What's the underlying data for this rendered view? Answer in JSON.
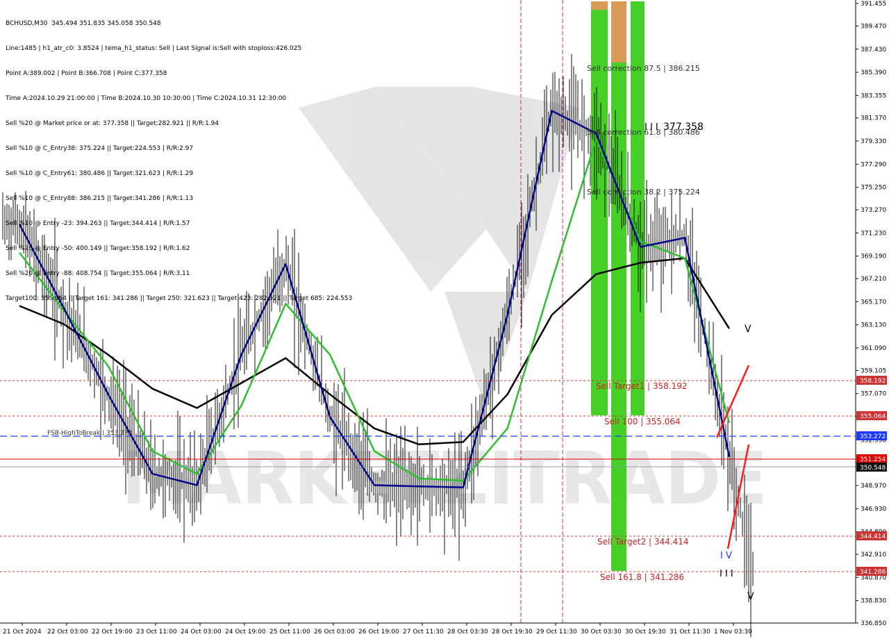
{
  "info_lines": [
    "BCHUSD,M30  345.494 351.835 345.058 350.548",
    "Line:1485 | h1_atr_c0: 3.8524 | tema_h1_status: Sell | Last Signal is:Sell with stoploss:426.025",
    "Point A:389.002 | Point B:366.708 | Point C:377.358",
    "Time A:2024.10.29 21:00:00 | Time B:2024.10.30 10:30:00 | Time C:2024.10.31 12:30:00",
    "Sell %20 @ Market price or at: 377.358 || Target:282.921 || R/R:1.94",
    "Sell %10 @ C_Entry38: 375.224 || Target:224.553 | R/R:2.97",
    "Sell %10 @ C_Entry61: 380.486 || Target:321.623 | R/R:1.29",
    "Sell %10 @ C_Entry88: 386.215 || Target:341.286 | R/R:1.13",
    "Sell %10 @ Entry -23: 394.263 || Target:344.414 | R/R:1.57",
    "Sell %20 @ Entry -50: 400.149 || Target:358.192 | R/R:1.62",
    "Sell %20 @ Entry -88: 408.754 || Target:355.064 | R/R:3.11",
    "Target100: 355.064 || Target 161: 341.286 || Target 250: 321.623 || Target 423: 282.921 || Target 685: 224.553"
  ],
  "watermark": "MARKETZITRADE",
  "axis": {
    "price_ticks": [
      "391.455",
      "389.470",
      "387.430",
      "385.390",
      "383.355",
      "381.370",
      "379.330",
      "377.290",
      "375.250",
      "373.270",
      "371.230",
      "369.190",
      "367.210",
      "365.170",
      "363.130",
      "361.090",
      "359.105",
      "357.070",
      "355.030",
      "352.990",
      "351.005",
      "348.970",
      "346.930",
      "344.890",
      "342.910",
      "340.870",
      "338.830",
      "336.850"
    ],
    "time_labels": [
      "21 Oct 2024",
      "22 Oct 03:00",
      "22 Oct 19:00",
      "23 Oct 11:00",
      "24 Oct 03:00",
      "24 Oct 19:00",
      "25 Oct 11:00",
      "26 Oct 03:00",
      "26 Oct 19:00",
      "27 Oct 11:30",
      "28 Oct 03:30",
      "28 Oct 19:30",
      "29 Oct 11:30",
      "30 Oct 03:30",
      "30 Oct 19:30",
      "31 Oct 11:30",
      "1 Nov 03:30"
    ]
  },
  "levels": {
    "target1": {
      "label": "Sell Target1 | 358.192",
      "badge": "358.192",
      "color": "#cc2222"
    },
    "sell100": {
      "label": "Sell 100 | 355.064",
      "badge": "355.064",
      "color": "#cc2222"
    },
    "fsb": {
      "label": "FSB-HighToBreak | 353.272",
      "badge": "353.272",
      "color": "#1f3bff"
    },
    "red_line": {
      "badge": "351.254",
      "color": "#e00000"
    },
    "current": {
      "badge": "350.548",
      "color": "#222222"
    },
    "target2": {
      "label": "Sell Target2 | 344.414",
      "badge": "344.414",
      "color": "#cc2222"
    },
    "sell161": {
      "label": "Sell 161.8 | 341.286",
      "badge": "341.286",
      "color": "#cc2222"
    },
    "extra_badge": "340.870"
  },
  "annotations": {
    "corr875": "Sell correction 87.5 | 386.215",
    "corr618": "Sell correction 61.8 | 380.486",
    "corr382": "Sell correction 38.2 | 375.224",
    "point_c": "377.358",
    "label_pointc_mark": "I I I",
    "label_mid": "I V",
    "label_bottom": "I I I",
    "label_v": "V"
  },
  "chart_data": {
    "type": "line",
    "title": "BCHUSD,M30",
    "ylim": [
      336.85,
      391.455
    ],
    "x": [
      "21 Oct 2024",
      "22 Oct 03:00",
      "22 Oct 19:00",
      "23 Oct 11:00",
      "24 Oct 03:00",
      "24 Oct 19:00",
      "25 Oct 11:00",
      "26 Oct 03:00",
      "26 Oct 19:00",
      "27 Oct 11:30",
      "28 Oct 03:30",
      "28 Oct 19:30",
      "29 Oct 11:30",
      "30 Oct 03:30",
      "30 Oct 19:30",
      "31 Oct 11:30",
      "1 Nov 03:30"
    ],
    "series": [
      {
        "color": "#000000",
        "values": [
          364.8,
          363.2,
          360.5,
          357.5,
          355.8,
          358.0,
          360.2,
          357.0,
          354.0,
          352.6,
          352.8,
          357.0,
          364.0,
          367.6,
          368.6,
          369.0,
          362.8
        ]
      },
      {
        "color": "#2dbf2d",
        "values": [
          369.5,
          364.4,
          359.5,
          352.0,
          350.0,
          356.0,
          365.0,
          360.5,
          352.0,
          349.6,
          349.4,
          354.0,
          367.0,
          379.5,
          370.5,
          369.0,
          354.5
        ]
      },
      {
        "color": "#00008b",
        "values": [
          372.0,
          364.6,
          357.0,
          350.0,
          349.0,
          360.5,
          368.5,
          355.0,
          349.0,
          348.9,
          348.8,
          364.0,
          382.0,
          380.0,
          370.0,
          370.8,
          351.5
        ]
      }
    ],
    "ylabel": "",
    "xlabel": ""
  }
}
